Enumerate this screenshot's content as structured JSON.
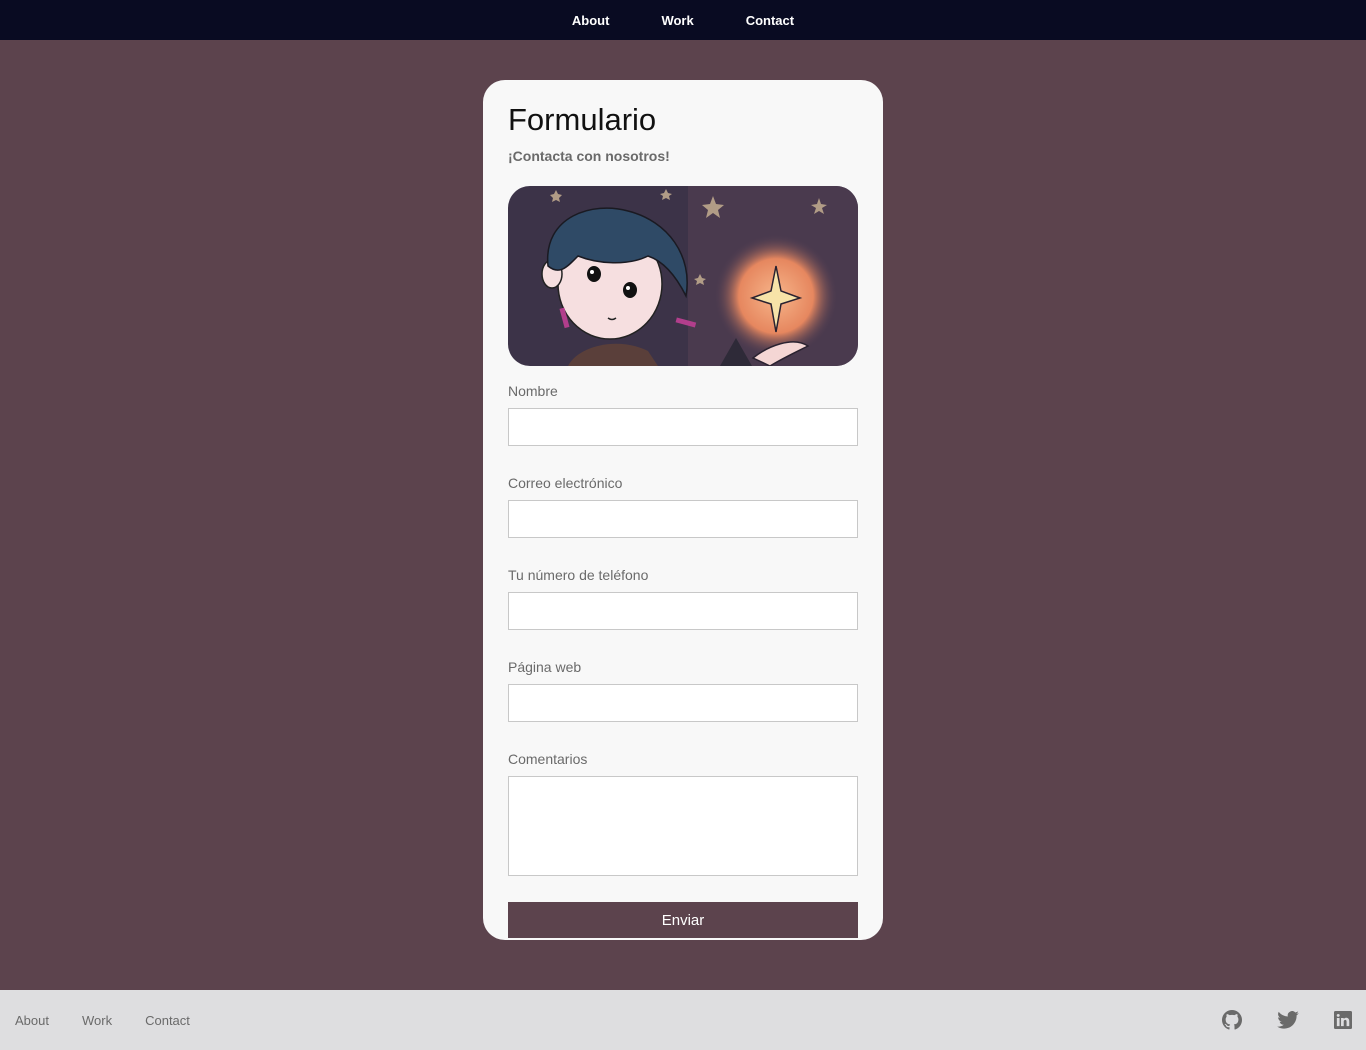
{
  "nav": {
    "items": [
      {
        "label": "About"
      },
      {
        "label": "Work"
      },
      {
        "label": "Contact"
      }
    ]
  },
  "form": {
    "title": "Formulario",
    "subtitle": "¡Contacta con nosotros!",
    "fields": [
      {
        "label": "Nombre",
        "value": ""
      },
      {
        "label": "Correo electrónico",
        "value": ""
      },
      {
        "label": "Tu número de teléfono",
        "value": ""
      },
      {
        "label": "Página web",
        "value": ""
      },
      {
        "label": "Comentarios",
        "value": ""
      }
    ],
    "submit_label": "Enviar"
  },
  "footer": {
    "links": [
      {
        "label": "About"
      },
      {
        "label": "Work"
      },
      {
        "label": "Contact"
      }
    ],
    "social": [
      "github-icon",
      "twitter-icon",
      "linkedin-icon"
    ]
  },
  "colors": {
    "background": "#5c434d",
    "nav_bg": "#090b22",
    "card_bg": "#f8f8f8",
    "button_bg": "#5c434d",
    "footer_bg": "#dedee0"
  }
}
